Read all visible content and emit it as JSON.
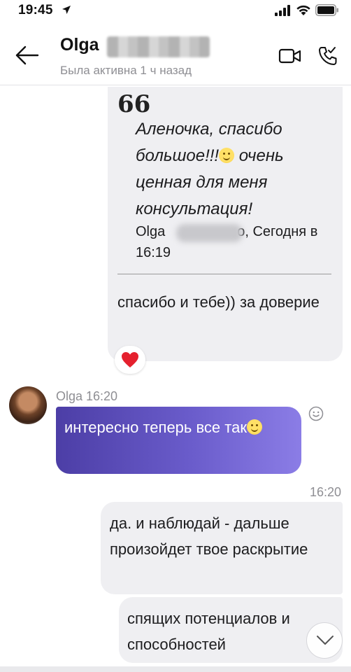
{
  "status_bar": {
    "time": "19:45"
  },
  "header": {
    "contact_name": "Olga",
    "last_seen": "Была активна 1 ч назад"
  },
  "quote_message": {
    "quote_mark": "66",
    "quote_text": "Аленочка, спасибо большое!!!",
    "quote_text_2": " очень ценная для меня консультация!",
    "quote_author": "Olga",
    "quote_author_suffix": "о, Сегодня в 16:19",
    "reply_text": "спасибо и тебе)) за доверие",
    "reaction": "heart"
  },
  "incoming_message": {
    "sender": "Olga 16:20",
    "text": "интересно теперь все так"
  },
  "outgoing_messages": {
    "time": "16:20",
    "message_1": "да. и наблюдай - дальше произойдет твое раскрытие",
    "message_2": "спящих потенциалов и способностей"
  },
  "colors": {
    "incoming_bubble_start": "#4c3ea6",
    "incoming_bubble_end": "#8b7de6",
    "outgoing_bubble": "#efeff2",
    "reaction_heart": "#e5202e",
    "meta_text": "#8e8e93"
  }
}
